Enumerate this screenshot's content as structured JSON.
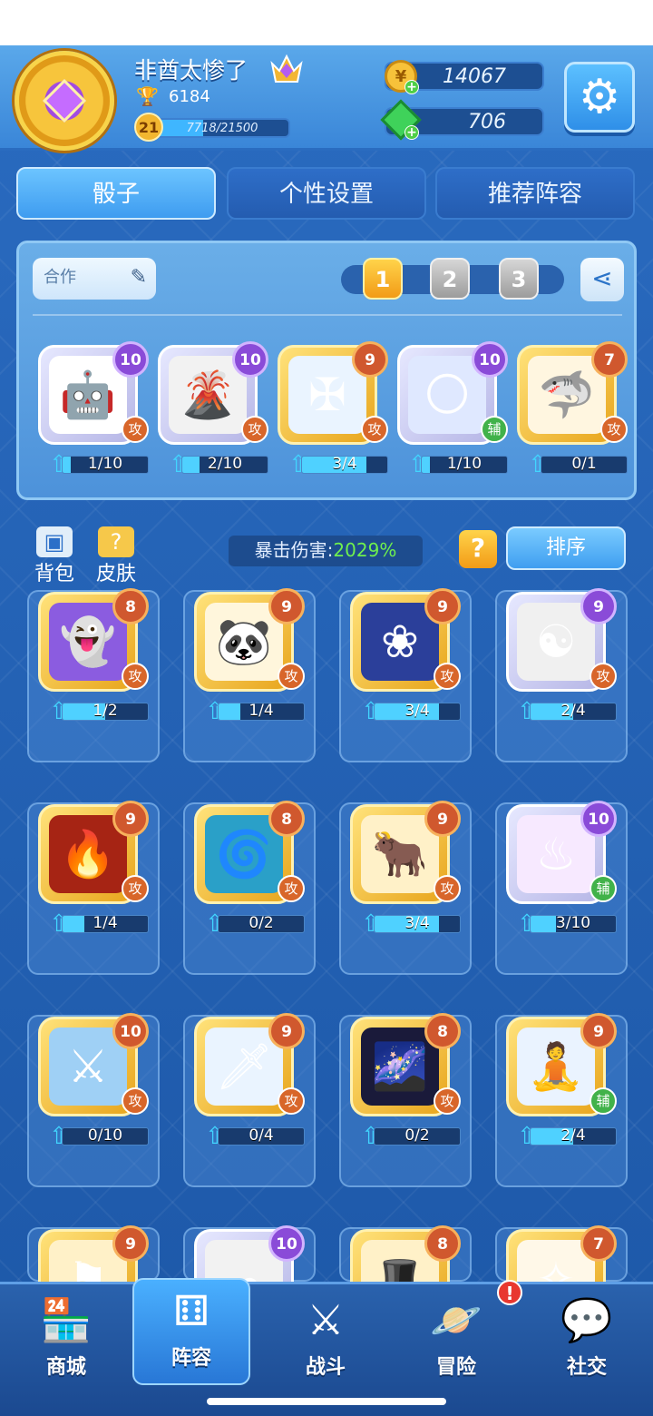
{
  "player": {
    "name": "非酋太惨了",
    "trophies": "6184",
    "level": "21",
    "xp_text": "7718/21500",
    "xp_fraction": 0.359
  },
  "currencies": {
    "gold": "14067",
    "gems": "706"
  },
  "tabs": [
    {
      "label": "骰子",
      "active": true
    },
    {
      "label": "个性设置",
      "active": false
    },
    {
      "label": "推荐阵容",
      "active": false
    }
  ],
  "deck": {
    "name": "合作",
    "slots": [
      "1",
      "2",
      "3"
    ],
    "active_slot": 0,
    "cards": [
      {
        "icon": "robot-icon",
        "level": "10",
        "tier": "purple",
        "type": "攻",
        "progress": "1/10",
        "fill": 0.1
      },
      {
        "icon": "volcano-icon",
        "level": "10",
        "tier": "purple",
        "type": "攻",
        "progress": "2/10",
        "fill": 0.2
      },
      {
        "icon": "frost-cross-icon",
        "level": "9",
        "tier": "orange",
        "type": "攻",
        "progress": "3/4",
        "fill": 0.75
      },
      {
        "icon": "moon-icon",
        "level": "10",
        "tier": "purple",
        "type": "辅",
        "progress": "1/10",
        "fill": 0.1
      },
      {
        "icon": "shark-icon",
        "level": "7",
        "tier": "orange",
        "type": "攻",
        "progress": "0/1",
        "fill": 0.0
      }
    ]
  },
  "toolbar": {
    "bag": "背包",
    "skin": "皮肤",
    "crit_label": "暴击伤害:",
    "crit_value": "2029%",
    "help": "?",
    "sort": "排序"
  },
  "collection": [
    {
      "icon": "ghost-icon",
      "level": "8",
      "tier": "orange",
      "type": "攻",
      "progress": "1/2",
      "fill": 0.5
    },
    {
      "icon": "panda-icon",
      "level": "9",
      "tier": "orange",
      "type": "攻",
      "progress": "1/4",
      "fill": 0.25
    },
    {
      "icon": "lotus-icon",
      "level": "9",
      "tier": "orange",
      "type": "攻",
      "progress": "3/4",
      "fill": 0.75
    },
    {
      "icon": "yin-yang-icon",
      "level": "9",
      "tier": "purple",
      "type": "攻",
      "progress": "2/4",
      "fill": 0.5
    },
    {
      "icon": "fire-icon",
      "level": "9",
      "tier": "orange",
      "type": "攻",
      "progress": "1/4",
      "fill": 0.25
    },
    {
      "icon": "whirlpool-icon",
      "level": "8",
      "tier": "orange",
      "type": "攻",
      "progress": "0/2",
      "fill": 0.0
    },
    {
      "icon": "bull-icon",
      "level": "9",
      "tier": "orange",
      "type": "攻",
      "progress": "3/4",
      "fill": 0.75
    },
    {
      "icon": "altar-icon",
      "level": "10",
      "tier": "purple",
      "type": "辅",
      "progress": "3/10",
      "fill": 0.3
    },
    {
      "icon": "sword-icon",
      "level": "10",
      "tier": "orange",
      "type": "攻",
      "progress": "0/10",
      "fill": 0.0
    },
    {
      "icon": "ice-sword-icon",
      "level": "9",
      "tier": "orange",
      "type": "攻",
      "progress": "0/4",
      "fill": 0.0
    },
    {
      "icon": "galaxy-icon",
      "level": "8",
      "tier": "orange",
      "type": "攻",
      "progress": "0/2",
      "fill": 0.0
    },
    {
      "icon": "monk-icon",
      "level": "9",
      "tier": "orange",
      "type": "辅",
      "progress": "2/4",
      "fill": 0.5
    },
    {
      "icon": "banner-icon",
      "level": "9",
      "tier": "orange",
      "type": "",
      "progress": "",
      "fill": 0.0
    },
    {
      "icon": "cloud-icon",
      "level": "10",
      "tier": "purple",
      "type": "",
      "progress": "",
      "fill": 0.0
    },
    {
      "icon": "witch-hat-icon",
      "level": "8",
      "tier": "orange",
      "type": "",
      "progress": "",
      "fill": 0.0
    },
    {
      "icon": "angel-wings-icon",
      "level": "7",
      "tier": "orange",
      "type": "",
      "progress": "",
      "fill": 0.0
    }
  ],
  "nav": [
    {
      "label": "商城",
      "icon": "shop-icon",
      "active": false
    },
    {
      "label": "阵容",
      "icon": "dice-icon",
      "active": true
    },
    {
      "label": "战斗",
      "icon": "swords-icon",
      "active": false
    },
    {
      "label": "冒险",
      "icon": "planet-icon",
      "active": false,
      "alert": "!"
    },
    {
      "label": "社交",
      "icon": "chat-icon",
      "active": false
    }
  ]
}
